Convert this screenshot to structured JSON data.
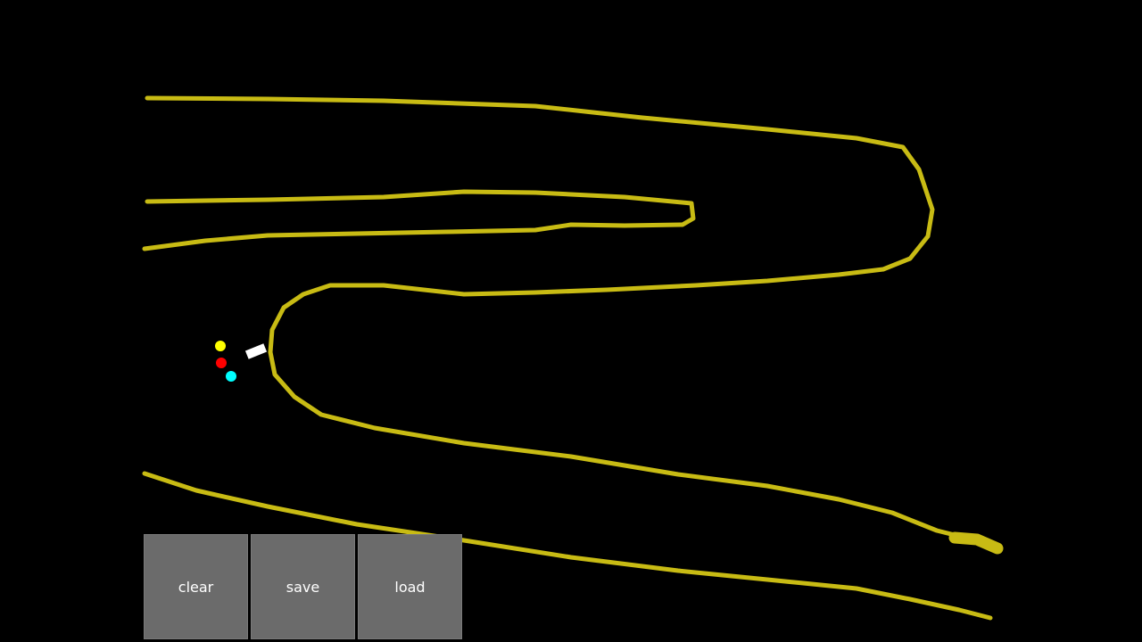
{
  "colors": {
    "background": "#000000",
    "track": "#c8bb14",
    "car": "#ffffff",
    "sensor_left": "#ffff00",
    "sensor_center": "#ff0000",
    "sensor_right": "#00ffff",
    "button_bg": "#6b6b6b",
    "button_text": "#ffffff"
  },
  "toolbar": {
    "clear_label": "clear",
    "save_label": "save",
    "load_label": "load"
  }
}
